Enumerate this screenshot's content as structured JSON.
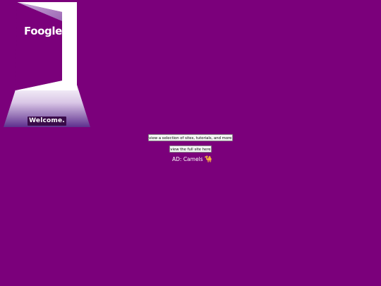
{
  "logo": {
    "text": "Foogle"
  },
  "welcome": {
    "label": "Welcome."
  },
  "buttons": {
    "selection_label": "view a selection of sites, tutorials, and more...",
    "full_site_label": "view the full site here"
  },
  "ad": {
    "label": "AD: Camels",
    "icon": "camel-icon",
    "glyph": "🐪"
  },
  "colors": {
    "background": "#7b007b",
    "badge": "#3a0b4a",
    "panel": "#ffffff"
  }
}
